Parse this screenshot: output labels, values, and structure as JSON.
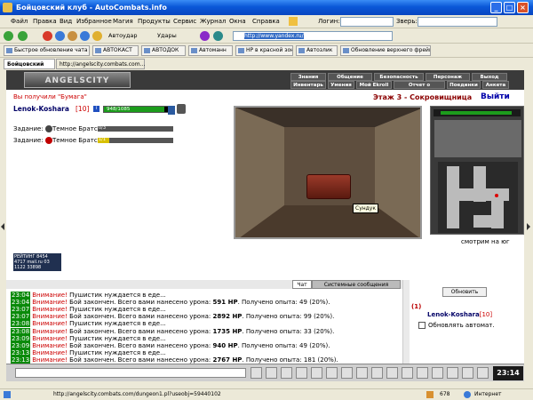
{
  "window": {
    "title": "Бойцовский клуб - AutoCombats.info"
  },
  "menubar": {
    "items": [
      "Файл",
      "Правка",
      "Вид",
      "Избранное",
      "Магия",
      "Продукты",
      "Сервис",
      "Журнал",
      "Окна",
      "Справка"
    ],
    "login_label": "Логин:",
    "beast_label": "Зверь:"
  },
  "toolbar": {
    "autoudar": "Автоудар",
    "udary": "Удары",
    "address": "http://www.yandex.ru/"
  },
  "links": [
    "Быстрое обновление чата",
    "АВТОКАСТ",
    "АВТОДОК",
    "Автоманн",
    "HP в красной зоне",
    "Автозлик",
    "Обновление верхнего фрейма"
  ],
  "tabs": [
    "Бойцовский клуб",
    "http://angelscity.combats.com..."
  ],
  "game": {
    "logo": "ANGELSCITY",
    "menu_row1": [
      "Знания",
      "Общение",
      "Безопасность",
      "Персонаж",
      "Выход"
    ],
    "menu_row2": [
      "Инвентарь",
      "Умения",
      "Мой Ekroll",
      "Отчет о переводах",
      "Поединки",
      "Анкета"
    ],
    "received_msg": "Вы получили \"Бумага\"",
    "floor": "Этаж 3 - Сокровищница",
    "exit": "Выйти",
    "player_name": "Lenok-Koshara",
    "player_level": "[10]",
    "info_icon": "i",
    "hp_text": "948/1085",
    "hp_fraction": 0.874,
    "tasks": [
      {
        "label": "Задание:",
        "name": "Темное Братство",
        "bar_text": "0/3",
        "fill": 0.0,
        "icon_color": "#444444"
      },
      {
        "label": "Задание:",
        "name": "Темное Братство",
        "bar_text": "1/1",
        "fill": 0.15,
        "icon_color": "#c00000"
      }
    ],
    "chest_tooltip": "Сундук",
    "look_label": "смотрим на юг",
    "counter": "РЕЙТИНГ 8454 4717 mail.ru 03 1122 33898"
  },
  "chat": {
    "tab_chat": "Чат",
    "tab_system": "Системные сообщения",
    "lines": [
      {
        "time": "23:04",
        "warn": "Внимание!",
        "text": "Пушистик нуждается в еде...",
        "bold": "",
        "suffix": ""
      },
      {
        "time": "23:04",
        "warn": "Внимание!",
        "text": "Бой закончен. Всего вами нанесено урона:",
        "bold": "591 HP",
        "suffix": ". Получено опыта: 49 (20%)."
      },
      {
        "time": "23:07",
        "warn": "Внимание!",
        "text": "Пушистик нуждается в еде...",
        "bold": "",
        "suffix": ""
      },
      {
        "time": "23:07",
        "warn": "Внимание!",
        "text": "Бой закончен. Всего вами нанесено урона:",
        "bold": "2892 HP",
        "suffix": ". Получено опыта: 99 (20%)."
      },
      {
        "time": "23:08",
        "warn": "Внимание!",
        "text": "Пушистик нуждается в еде...",
        "bold": "",
        "suffix": ""
      },
      {
        "time": "23:08",
        "warn": "Внимание!",
        "text": "Бой закончен. Всего вами нанесено урона:",
        "bold": "1735 HP",
        "suffix": ". Получено опыта: 33 (20%)."
      },
      {
        "time": "23:09",
        "warn": "Внимание!",
        "text": "Пушистик нуждается в еде...",
        "bold": "",
        "suffix": ""
      },
      {
        "time": "23:09",
        "warn": "Внимание!",
        "text": "Бой закончен. Всего вами нанесено урона:",
        "bold": "940 HP",
        "suffix": ". Получено опыта: 49 (20%)."
      },
      {
        "time": "23:13",
        "warn": "Внимание!",
        "text": "Пушистик нуждается в еде...",
        "bold": "",
        "suffix": ""
      },
      {
        "time": "23:13",
        "warn": "Внимание!",
        "text": "Бой закончен. Всего вами нанесено урона:",
        "bold": "2767 HP",
        "suffix": ". Получено опыта: 181 (20%)."
      }
    ]
  },
  "side": {
    "refresh_label": "Обновить",
    "count": "(1)",
    "player": "Lenok-Koshara",
    "level": "[10]",
    "auto_label": "Обновлять автомат."
  },
  "clock": "23:14",
  "status": {
    "url": "http://angelscity.combats.com/dungeon1.pl?useobj=59440102",
    "count": "678",
    "zone": "Интернет"
  }
}
